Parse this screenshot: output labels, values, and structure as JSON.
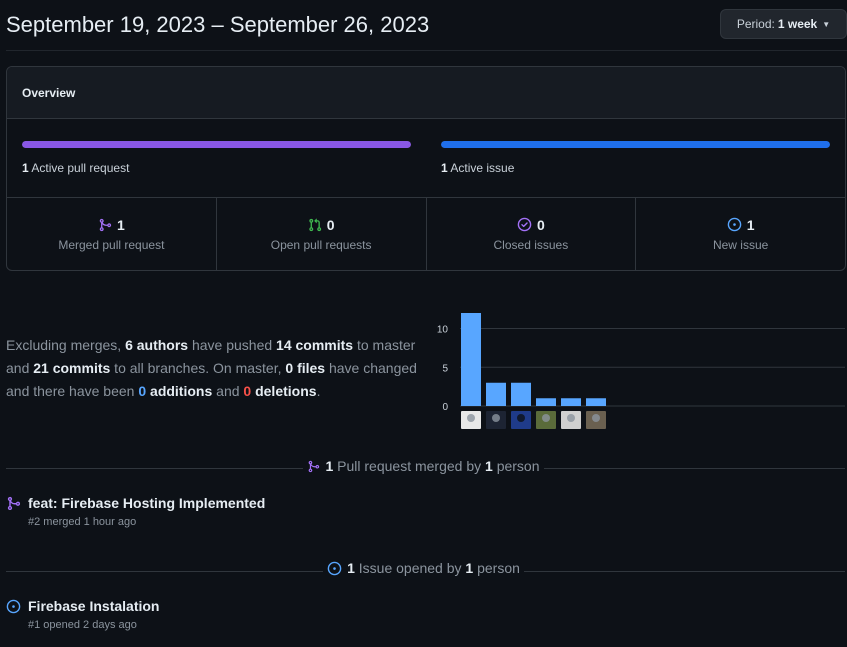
{
  "header": {
    "date_range": "September 19, 2023 – September 26, 2023",
    "period_label": "Period:",
    "period_value": "1 week"
  },
  "overview": {
    "title": "Overview",
    "pr_bar": {
      "count": "1",
      "label": "Active pull request",
      "fill_fraction": 1.0,
      "color": "#8957e5"
    },
    "issue_bar": {
      "count": "1",
      "label": "Active issue",
      "fill_fraction": 1.0,
      "color": "#1f6feb"
    },
    "stats": [
      {
        "icon": "git-merge-icon",
        "count": "1",
        "label": "Merged pull request",
        "color": "#a371f7"
      },
      {
        "icon": "git-pull-request-icon",
        "count": "0",
        "label": "Open pull requests",
        "color": "#3fb950"
      },
      {
        "icon": "issue-closed-icon",
        "count": "0",
        "label": "Closed issues",
        "color": "#a371f7"
      },
      {
        "icon": "issue-opened-icon",
        "count": "1",
        "label": "New issue",
        "color": "#58a6ff"
      }
    ]
  },
  "summary": {
    "p1": "Excluding merges, ",
    "authors": "6 authors",
    "p2": " have pushed ",
    "commits_master": "14 commits",
    "p3": " to master and ",
    "commits_all": "21 commits",
    "p4": " to all branches. On master, ",
    "files": "0 files",
    "p5": " have changed and there have been ",
    "additions_num": "0",
    "additions_word": " additions",
    "p6": " and ",
    "deletions_num": "0",
    "deletions_word": " deletions",
    "p7": "."
  },
  "chart_data": {
    "type": "bar",
    "categories": [
      "author-1",
      "author-2",
      "author-3",
      "author-4",
      "author-5",
      "author-6"
    ],
    "values": [
      12,
      3,
      3,
      1,
      1,
      1
    ],
    "y_ticks": [
      "10",
      "5",
      "0"
    ],
    "ylim": [
      0,
      12
    ],
    "bar_color": "#58a6ff",
    "grid": true
  },
  "merged_section": {
    "count": "1",
    "text1": " Pull request merged by ",
    "people": "1",
    "text2": " person",
    "items": [
      {
        "icon": "git-merge-icon",
        "title": "feat: Firebase Hosting Implemented",
        "meta": "#2 merged 1 hour ago"
      }
    ]
  },
  "issues_section": {
    "count": "1",
    "text1": " Issue opened by ",
    "people": "1",
    "text2": " person",
    "items": [
      {
        "icon": "issue-opened-icon",
        "title": "Firebase Instalation",
        "meta": "#1 opened 2 days ago"
      }
    ]
  }
}
